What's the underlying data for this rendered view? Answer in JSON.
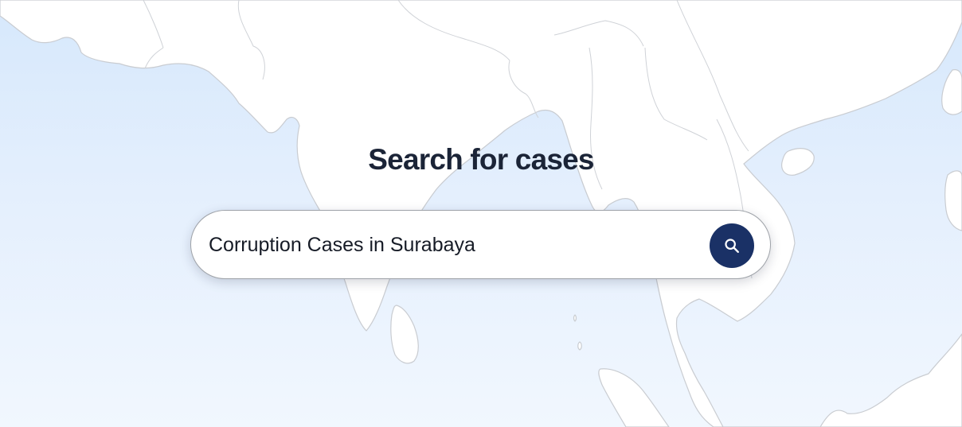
{
  "page": {
    "title": "Search for cases"
  },
  "search": {
    "value": "Corruption Cases in Surabaya",
    "button_icon": "search-icon"
  },
  "colors": {
    "title": "#1b2437",
    "button": "#1a3166",
    "sea": "#d6e8fc",
    "land": "#ffffff"
  }
}
